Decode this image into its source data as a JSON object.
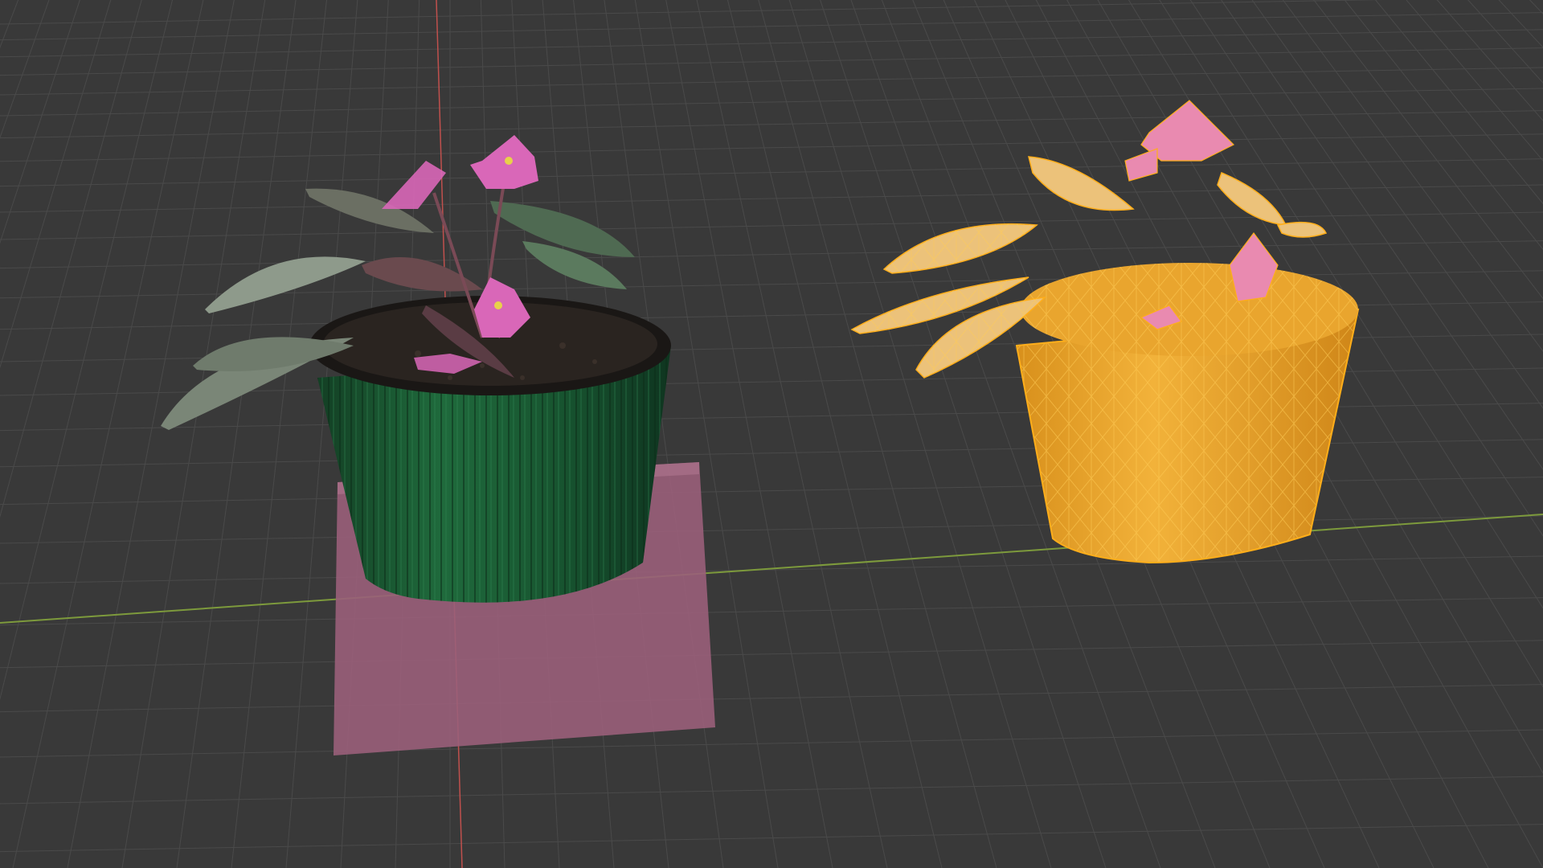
{
  "viewport": {
    "name": "3d-viewport",
    "background": "#393939",
    "grid_color": "#4a4a4a",
    "x_axis_color": "#7d9a3c",
    "y_axis_color": "#c0504d"
  },
  "objects": [
    {
      "name": "textured-plant-model",
      "state": "unselected",
      "display": "textured",
      "pot_color": "#1d5a34",
      "soil_color": "#2a2420",
      "leaf_color": "#7c8a78",
      "flower_color": "#d967b8"
    },
    {
      "name": "selected-plant-model",
      "state": "selected",
      "display": "wireframe-overlay",
      "selection_color": "#f0a020",
      "flower_color": "#e98ab0"
    },
    {
      "name": "pink-base-block",
      "state": "unselected",
      "display": "solid",
      "color": "#9a5f7a"
    }
  ]
}
